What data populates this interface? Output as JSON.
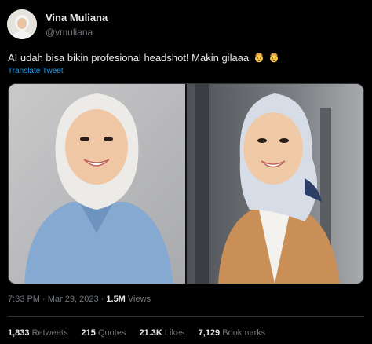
{
  "author": {
    "display_name": "Vina Muliana",
    "handle": "@vmuliana"
  },
  "tweet": {
    "text": "AI udah bisa bikin profesional headshot! Makin gilaaa",
    "emojis": [
      "exploding-head-emoji",
      "exploding-head-emoji"
    ],
    "translate_label": "Translate Tweet"
  },
  "media": {
    "photos": [
      {
        "icon": "headshot-photo-blue-shirt",
        "background": "#bfc0c2",
        "clothing": "#7ea4cf"
      },
      {
        "icon": "headshot-photo-cardigan",
        "background": "#6e7176",
        "clothing": "#c58a52"
      }
    ]
  },
  "meta": {
    "time": "7:33 PM",
    "separator": "·",
    "date": "Mar 29, 2023",
    "views_count": "1.5M",
    "views_label": "Views"
  },
  "stats": {
    "retweets_count": "1,833",
    "retweets_label": "Retweets",
    "quotes_count": "215",
    "quotes_label": "Quotes",
    "likes_count": "21.3K",
    "likes_label": "Likes",
    "bookmarks_count": "7,129",
    "bookmarks_label": "Bookmarks"
  },
  "colors": {
    "background": "#000000",
    "text_primary": "#e7e9ea",
    "text_secondary": "#71767b",
    "link": "#1d9bf0",
    "divider": "#2f3336"
  }
}
